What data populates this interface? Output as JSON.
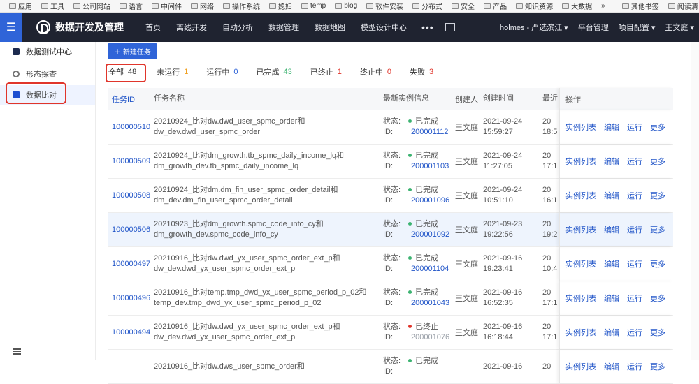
{
  "bookmarks": {
    "items": [
      "应用",
      "工具",
      "公司网站",
      "语言",
      "中间件",
      "网络",
      "操作系统",
      "媳妇",
      "temp",
      "blog",
      "软件安装",
      "分布式",
      "安全",
      "产品",
      "知识资源",
      "大数据"
    ],
    "more": "»",
    "other": "其他书签",
    "reading": "阅读清单"
  },
  "appbar": {
    "title": "数据开发及管理",
    "nav": [
      "首页",
      "离线开发",
      "自助分析",
      "数据管理",
      "数据地图",
      "模型设计中心"
    ],
    "dots": "•••",
    "project": "holmes - 严选滨江 ▾",
    "platform": "平台管理",
    "config": "项目配置 ▾",
    "user": "王文庭 ▾"
  },
  "sidebar": {
    "header": "数据测试中心",
    "items": [
      "形态探查",
      "数据比对"
    ]
  },
  "main": {
    "new_task": "＋ 新建任务",
    "tabs": [
      {
        "label": "全部",
        "count": "48",
        "color": "#333333"
      },
      {
        "label": "未运行",
        "count": "1",
        "color": "#f0a020"
      },
      {
        "label": "运行中",
        "count": "0",
        "color": "#2f64d8"
      },
      {
        "label": "已完成",
        "count": "43",
        "color": "#3cb371"
      },
      {
        "label": "已终止",
        "count": "1",
        "color": "#e0352b"
      },
      {
        "label": "终止中",
        "count": "0",
        "color": "#e0352b"
      },
      {
        "label": "失败",
        "count": "3",
        "color": "#e0352b"
      }
    ],
    "columns": {
      "id": "任务ID",
      "name": "任务名称",
      "instance": "最新实例信息",
      "creator": "创建人",
      "created": "创建时间",
      "recent": "最近",
      "ops": "操作"
    },
    "ops": [
      "实例列表",
      "编辑",
      "运行",
      "更多"
    ],
    "status_label": "状态:",
    "id_label": "ID:",
    "rows": [
      {
        "id": "100000510",
        "name1": "20210924_比对dw.dwd_user_spmc_order和",
        "name2": "dw_dev.dwd_user_spmc_order",
        "status": "已完成",
        "status_color": "#3cb371",
        "inst": "200001112",
        "creator": "王文庭",
        "date": "2021-09-24",
        "time": "15:59:27",
        "r1": "20",
        "r2": "18:5"
      },
      {
        "id": "100000509",
        "name1": "20210924_比对dm_growth.tb_spmc_daily_income_lq和",
        "name2": "dm_growth_dev.tb_spmc_daily_income_lq",
        "status": "已完成",
        "status_color": "#3cb371",
        "inst": "200001103",
        "creator": "王文庭",
        "date": "2021-09-24",
        "time": "11:27:05",
        "r1": "20",
        "r2": "17:1"
      },
      {
        "id": "100000508",
        "name1": "20210924_比对dm.dm_fin_user_spmc_order_detail和",
        "name2": "dm_dev.dm_fin_user_spmc_order_detail",
        "status": "已完成",
        "status_color": "#3cb371",
        "inst": "200001096",
        "creator": "王文庭",
        "date": "2021-09-24",
        "time": "10:51:10",
        "r1": "20",
        "r2": "16:1"
      },
      {
        "id": "100000506",
        "name1": "20210923_比对dm_growth.spmc_code_info_cy和",
        "name2": "dm_growth_dev.spmc_code_info_cy",
        "status": "已完成",
        "status_color": "#3cb371",
        "inst": "200001092",
        "creator": "王文庭",
        "date": "2021-09-23",
        "time": "19:22:56",
        "r1": "20",
        "r2": "19:2"
      },
      {
        "id": "100000497",
        "name1": "20210916_比对dw.dwd_yx_user_spmc_order_ext_p和",
        "name2": "dw_dev.dwd_yx_user_spmc_order_ext_p",
        "status": "已完成",
        "status_color": "#3cb371",
        "inst": "200001104",
        "creator": "王文庭",
        "date": "2021-09-16",
        "time": "19:23:41",
        "r1": "20",
        "r2": "10:4"
      },
      {
        "id": "100000496",
        "name1": "20210916_比对temp.tmp_dwd_yx_user_spmc_period_p_02和",
        "name2": "temp_dev.tmp_dwd_yx_user_spmc_period_p_02",
        "status": "已完成",
        "status_color": "#3cb371",
        "inst": "200001043",
        "creator": "王文庭",
        "date": "2021-09-16",
        "time": "16:52:35",
        "r1": "20",
        "r2": "17:1"
      },
      {
        "id": "100000494",
        "name1": "20210916_比对dw.dwd_yx_user_spmc_order_ext_p和",
        "name2": "dw_dev.dwd_yx_user_spmc_order_ext_p",
        "status": "已终止",
        "status_color": "#e0352b",
        "inst": "200001076",
        "creator": "王文庭",
        "date": "2021-09-16",
        "time": "16:18:44",
        "r1": "20",
        "r2": "17:1"
      },
      {
        "id": "",
        "name1": "20210916_比对dw.dws_user_spmc_order和",
        "name2": "",
        "status": "已完成",
        "status_color": "#3cb371",
        "inst": "",
        "creator": "",
        "date": "2021-09-16",
        "time": "",
        "r1": "20",
        "r2": ""
      }
    ]
  }
}
